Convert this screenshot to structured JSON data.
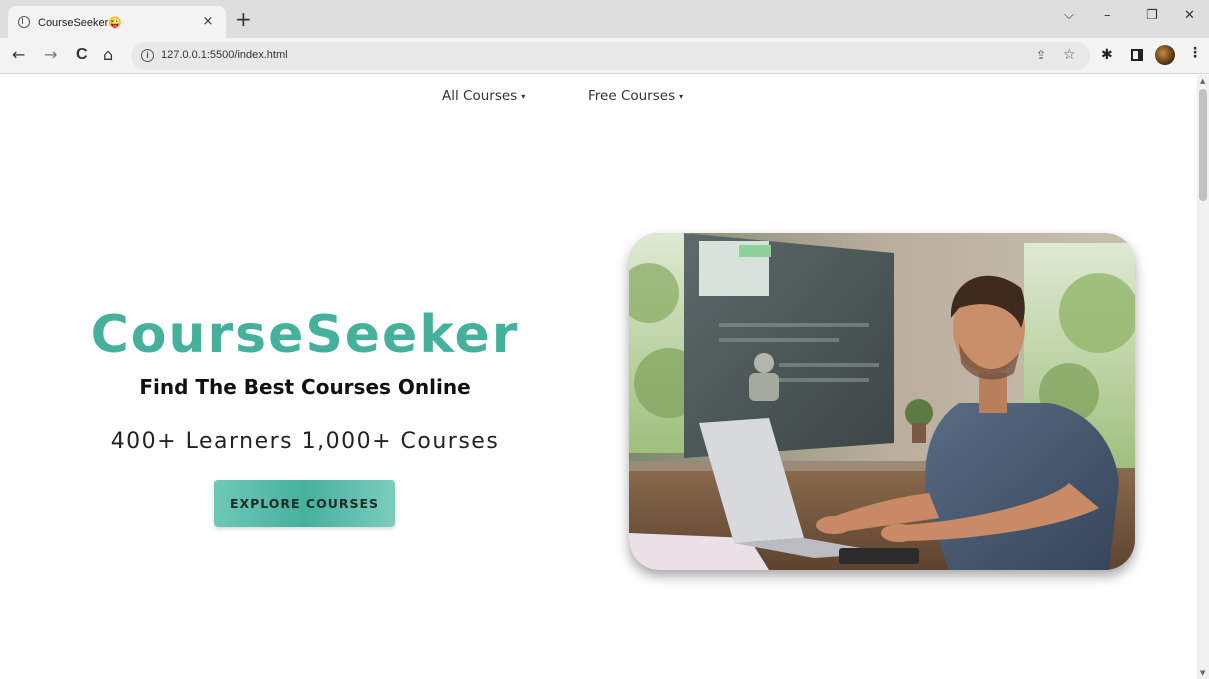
{
  "browser": {
    "tab_title": "CourseSeeker😜",
    "tab_close": "×",
    "new_tab": "+",
    "url": "127.0.0.1:5500/index.html",
    "window_controls": {
      "tabsearch": "⌵",
      "minimize": "–",
      "restore": "❐",
      "close": "✕"
    },
    "nav": {
      "back": "←",
      "forward": "→",
      "reload": "C",
      "home": "⌂"
    }
  },
  "site": {
    "nav": [
      {
        "label": "All Courses",
        "caret": "▾"
      },
      {
        "label": "Free Courses",
        "caret": "▾"
      }
    ],
    "hero": {
      "brand": "CourseSeeker",
      "tagline": "Find The Best Courses Online",
      "stats": "400+ Learners 1,000+ Courses",
      "cta": "EXPLORE COURSES"
    }
  },
  "colors": {
    "brand": "#45b19c",
    "button": "#5fbfab"
  }
}
